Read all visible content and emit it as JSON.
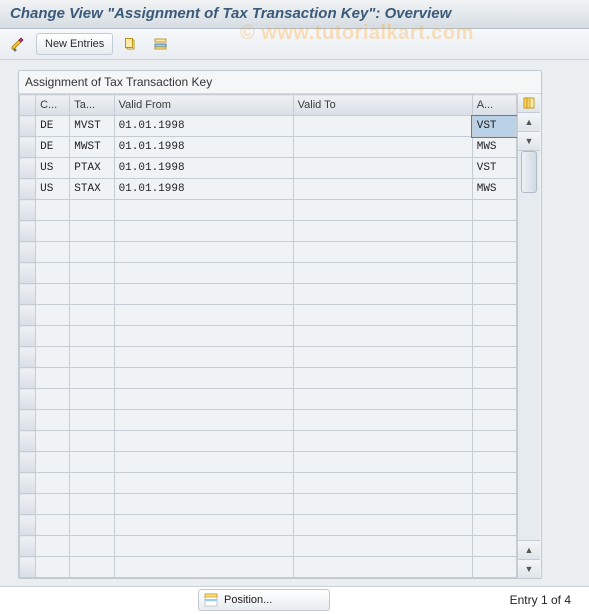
{
  "window": {
    "title": "Change View \"Assignment of Tax Transaction Key\": Overview"
  },
  "toolbar": {
    "new_entries_label": "New Entries"
  },
  "watermark": {
    "text": "© www.tutorialkart.com"
  },
  "panel": {
    "title": "Assignment of Tax Transaction Key"
  },
  "columns": {
    "country": "C...",
    "tax_type": "Ta...",
    "valid_from": "Valid From",
    "valid_to": "Valid To",
    "acct_key": "A..."
  },
  "rows": [
    {
      "country": "DE",
      "tax_type": "MVST",
      "valid_from": "01.01.1998",
      "valid_to": "",
      "acct_key": "VST"
    },
    {
      "country": "DE",
      "tax_type": "MWST",
      "valid_from": "01.01.1998",
      "valid_to": "",
      "acct_key": "MWS"
    },
    {
      "country": "US",
      "tax_type": "PTAX",
      "valid_from": "01.01.1998",
      "valid_to": "",
      "acct_key": "VST"
    },
    {
      "country": "US",
      "tax_type": "STAX",
      "valid_from": "01.01.1998",
      "valid_to": "",
      "acct_key": "MWS"
    }
  ],
  "empty_row_count": 18,
  "footer": {
    "position_label": "Position...",
    "entry_text": "Entry 1 of 4"
  }
}
